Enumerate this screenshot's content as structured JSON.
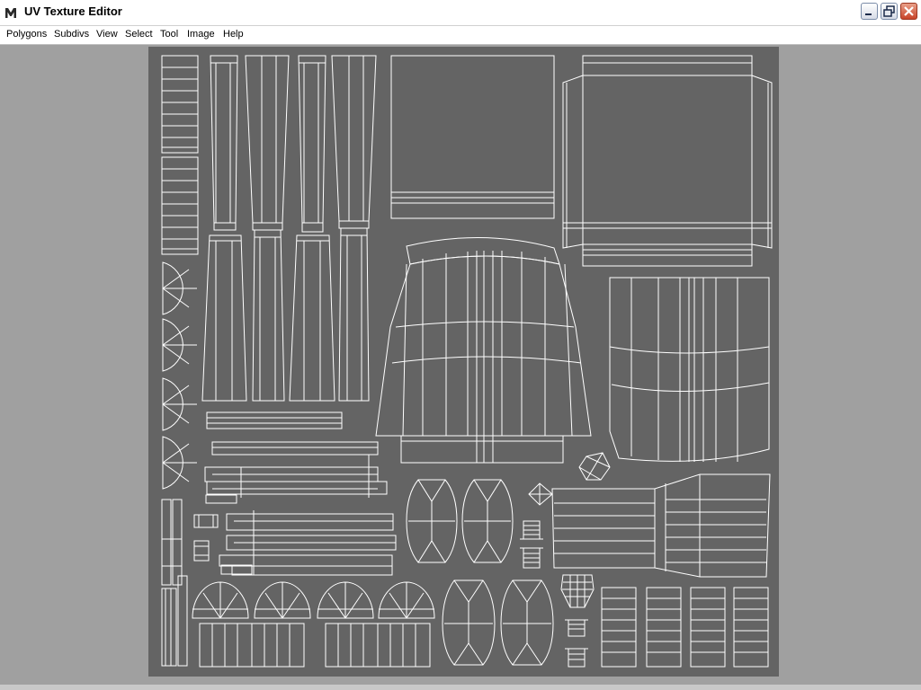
{
  "window": {
    "title": "UV Texture Editor",
    "minimize_icon": "minimize-icon",
    "restore_icon": "restore-icon",
    "close_icon": "close-icon"
  },
  "menubar": {
    "items": [
      {
        "label": "Polygons"
      },
      {
        "label": "Subdivs"
      },
      {
        "label": "View"
      },
      {
        "label": "Select"
      },
      {
        "label": "Tool"
      },
      {
        "label": "Image"
      },
      {
        "label": "Help"
      }
    ]
  },
  "canvas": {
    "background_color": "#646464",
    "wire_color": "#ffffff",
    "workspace_color": "#a0a0a0"
  }
}
